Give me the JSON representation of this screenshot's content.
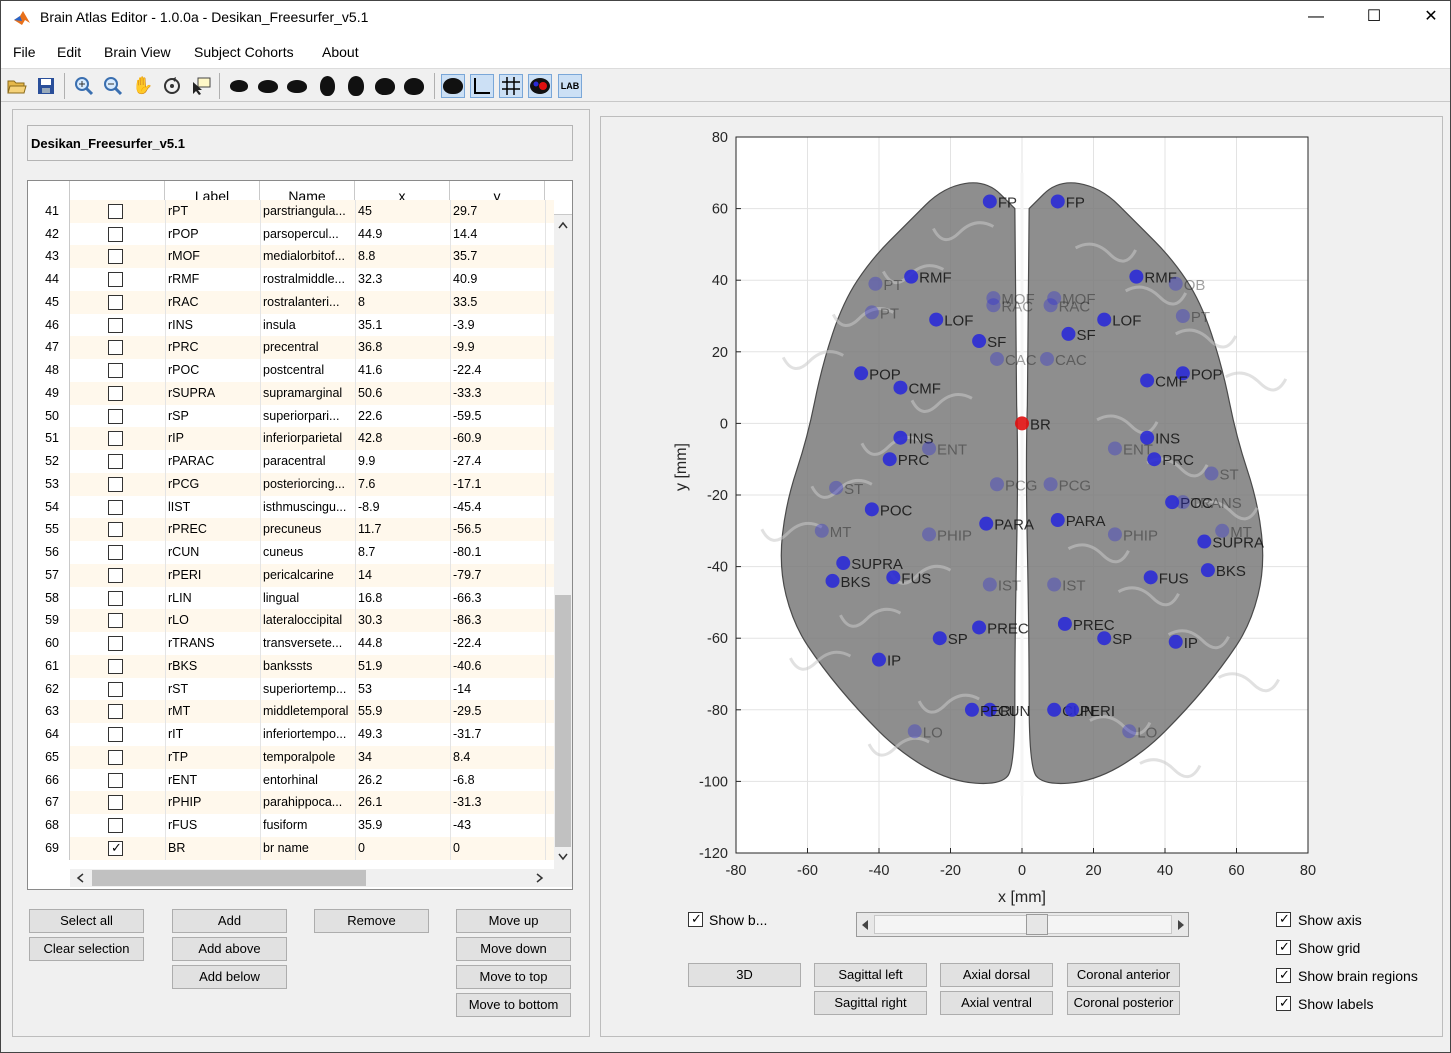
{
  "window": {
    "title": "Brain Atlas Editor - 1.0.0a - Desikan_Freesurfer_v5.1",
    "controls": {
      "minimize": "—",
      "maximize": "☐",
      "close": "✕"
    }
  },
  "menu": [
    "File",
    "Edit",
    "Brain View",
    "Subject Cohorts",
    "About"
  ],
  "toolbar": {
    "file_icons": [
      "open-icon",
      "save-icon"
    ],
    "tool_icons": [
      "zoom-in-icon",
      "zoom-out-icon",
      "pan-icon",
      "rotate-icon",
      "data-cursor-icon"
    ],
    "view_icons": [
      "brain-left-icon",
      "brain-sagittal-icon",
      "brain-sagittal-right-icon",
      "brain-axial-dorsal-icon",
      "brain-axial-ventral-icon",
      "brain-coronal-anterior-icon",
      "brain-coronal-posterior-icon"
    ],
    "toggle_icons": [
      "brain-surface-icon",
      "axis-icon",
      "grid-icon",
      "brain-regions-icon",
      "labels-icon"
    ],
    "labels_text": "LAB"
  },
  "atlas_name": "Desikan_Freesurfer_v5.1",
  "table": {
    "headers": [
      "",
      "",
      "Label",
      "Name",
      "x",
      "y"
    ],
    "partial_row": {
      "num": "41",
      "label": "rPT",
      "name": "parstriangula...",
      "x": "45",
      "y": "29.7"
    },
    "rows": [
      {
        "num": "42",
        "checked": false,
        "label": "rPOP",
        "name": "parsopercul...",
        "x": "44.9",
        "y": "14.4"
      },
      {
        "num": "43",
        "checked": false,
        "label": "rMOF",
        "name": "medialorbitof...",
        "x": "8.8",
        "y": "35.7"
      },
      {
        "num": "44",
        "checked": false,
        "label": "rRMF",
        "name": "rostralmiddle...",
        "x": "32.3",
        "y": "40.9"
      },
      {
        "num": "45",
        "checked": false,
        "label": "rRAC",
        "name": "rostralanteri...",
        "x": "8",
        "y": "33.5"
      },
      {
        "num": "46",
        "checked": false,
        "label": "rINS",
        "name": "insula",
        "x": "35.1",
        "y": "-3.9"
      },
      {
        "num": "47",
        "checked": false,
        "label": "rPRC",
        "name": "precentral",
        "x": "36.8",
        "y": "-9.9"
      },
      {
        "num": "48",
        "checked": false,
        "label": "rPOC",
        "name": "postcentral",
        "x": "41.6",
        "y": "-22.4"
      },
      {
        "num": "49",
        "checked": false,
        "label": "rSUPRA",
        "name": "supramarginal",
        "x": "50.6",
        "y": "-33.3"
      },
      {
        "num": "50",
        "checked": false,
        "label": "rSP",
        "name": "superiorpari...",
        "x": "22.6",
        "y": "-59.5"
      },
      {
        "num": "51",
        "checked": false,
        "label": "rIP",
        "name": "inferiorparietal",
        "x": "42.8",
        "y": "-60.9"
      },
      {
        "num": "52",
        "checked": false,
        "label": "rPARAC",
        "name": "paracentral",
        "x": "9.9",
        "y": "-27.4"
      },
      {
        "num": "53",
        "checked": false,
        "label": "rPCG",
        "name": "posteriorcing...",
        "x": "7.6",
        "y": "-17.1"
      },
      {
        "num": "54",
        "checked": false,
        "label": "lIST",
        "name": "isthmuscingu...",
        "x": "-8.9",
        "y": "-45.4"
      },
      {
        "num": "55",
        "checked": false,
        "label": "rPREC",
        "name": "precuneus",
        "x": "11.7",
        "y": "-56.5"
      },
      {
        "num": "56",
        "checked": false,
        "label": "rCUN",
        "name": "cuneus",
        "x": "8.7",
        "y": "-80.1"
      },
      {
        "num": "57",
        "checked": false,
        "label": "rPERI",
        "name": "pericalcarine",
        "x": "14",
        "y": "-79.7"
      },
      {
        "num": "58",
        "checked": false,
        "label": "rLIN",
        "name": "lingual",
        "x": "16.8",
        "y": "-66.3"
      },
      {
        "num": "59",
        "checked": false,
        "label": "rLO",
        "name": "lateraloccipital",
        "x": "30.3",
        "y": "-86.3"
      },
      {
        "num": "60",
        "checked": false,
        "label": "rTRANS",
        "name": "transversete...",
        "x": "44.8",
        "y": "-22.4"
      },
      {
        "num": "61",
        "checked": false,
        "label": "rBKS",
        "name": "bankssts",
        "x": "51.9",
        "y": "-40.6"
      },
      {
        "num": "62",
        "checked": false,
        "label": "rST",
        "name": "superiortemp...",
        "x": "53",
        "y": "-14"
      },
      {
        "num": "63",
        "checked": false,
        "label": "rMT",
        "name": "middletemporal",
        "x": "55.9",
        "y": "-29.5"
      },
      {
        "num": "64",
        "checked": false,
        "label": "rIT",
        "name": "inferiortempo...",
        "x": "49.3",
        "y": "-31.7"
      },
      {
        "num": "65",
        "checked": false,
        "label": "rTP",
        "name": "temporalpole",
        "x": "34",
        "y": "8.4"
      },
      {
        "num": "66",
        "checked": false,
        "label": "rENT",
        "name": "entorhinal",
        "x": "26.2",
        "y": "-6.8"
      },
      {
        "num": "67",
        "checked": false,
        "label": "rPHIP",
        "name": "parahippoca...",
        "x": "26.1",
        "y": "-31.3"
      },
      {
        "num": "68",
        "checked": false,
        "label": "rFUS",
        "name": "fusiform",
        "x": "35.9",
        "y": "-43"
      },
      {
        "num": "69",
        "checked": true,
        "label": "BR",
        "name": "br name",
        "x": "0",
        "y": "0"
      }
    ]
  },
  "buttons": {
    "select_all": "Select all",
    "clear_selection": "Clear selection",
    "add": "Add",
    "add_above": "Add above",
    "add_below": "Add below",
    "remove": "Remove",
    "move_up": "Move up",
    "move_down": "Move down",
    "move_to_top": "Move to top",
    "move_to_bottom": "Move to bottom"
  },
  "view_controls": {
    "show_brain": {
      "label": "Show b...",
      "checked": true
    },
    "slider_value": 0.55,
    "buttons": [
      "3D",
      "Sagittal left",
      "Sagittal right",
      "Axial dorsal",
      "Axial ventral",
      "Coronal anterior",
      "Coronal posterior"
    ],
    "show_axis": {
      "label": "Show axis",
      "checked": true
    },
    "show_grid": {
      "label": "Show grid",
      "checked": true
    },
    "show_brain_regions": {
      "label": "Show brain regions",
      "checked": true
    },
    "show_labels": {
      "label": "Show labels",
      "checked": true
    }
  },
  "chart_data": {
    "type": "scatter",
    "xlabel": "x [mm]",
    "ylabel": "y [mm]",
    "xlim": [
      -80,
      80
    ],
    "ylim": [
      -120,
      80
    ],
    "xticks": [
      -80,
      -60,
      -40,
      -20,
      0,
      20,
      40,
      60,
      80
    ],
    "yticks": [
      -120,
      -100,
      -80,
      -60,
      -40,
      -20,
      0,
      20,
      40,
      60,
      80
    ],
    "grid": true,
    "colors": {
      "region": "#2b2bd6",
      "selected": "#e01010",
      "brain": "#7a7a7a"
    },
    "points": [
      {
        "label": "FP",
        "x": -9,
        "y": 62,
        "hidden": false
      },
      {
        "label": "FP",
        "x": 10,
        "y": 62,
        "hidden": false
      },
      {
        "label": "RMF",
        "x": -31,
        "y": 41,
        "hidden": false
      },
      {
        "label": "RMF",
        "x": 32,
        "y": 41,
        "hidden": false
      },
      {
        "label": "PT",
        "x": -41,
        "y": 39,
        "hidden": true
      },
      {
        "label": "OB",
        "x": 43,
        "y": 39,
        "hidden": true
      },
      {
        "label": "LOF",
        "x": -24,
        "y": 29,
        "hidden": false
      },
      {
        "label": "LOF",
        "x": 23,
        "y": 29,
        "hidden": false
      },
      {
        "label": "MOF",
        "x": -8,
        "y": 35,
        "hidden": true
      },
      {
        "label": "MOF",
        "x": 9,
        "y": 35,
        "hidden": true
      },
      {
        "label": "RAC",
        "x": -8,
        "y": 33,
        "hidden": true
      },
      {
        "label": "RAC",
        "x": 8,
        "y": 33,
        "hidden": true
      },
      {
        "label": "PT",
        "x": -42,
        "y": 31,
        "hidden": true
      },
      {
        "label": "PT",
        "x": 45,
        "y": 30,
        "hidden": true
      },
      {
        "label": "SF",
        "x": -12,
        "y": 23,
        "hidden": false
      },
      {
        "label": "SF",
        "x": 13,
        "y": 25,
        "hidden": false
      },
      {
        "label": "CAC",
        "x": -7,
        "y": 18,
        "hidden": true
      },
      {
        "label": "CAC",
        "x": 7,
        "y": 18,
        "hidden": true
      },
      {
        "label": "POP",
        "x": -45,
        "y": 14,
        "hidden": false
      },
      {
        "label": "POP",
        "x": 45,
        "y": 14,
        "hidden": false
      },
      {
        "label": "CMF",
        "x": -34,
        "y": 10,
        "hidden": false
      },
      {
        "label": "CMF",
        "x": 35,
        "y": 12,
        "hidden": false
      },
      {
        "label": "BR",
        "x": 0,
        "y": 0,
        "hidden": false,
        "selected": true
      },
      {
        "label": "INS",
        "x": -34,
        "y": -4,
        "hidden": false
      },
      {
        "label": "INS",
        "x": 35,
        "y": -4,
        "hidden": false
      },
      {
        "label": "ENT",
        "x": -26,
        "y": -7,
        "hidden": true
      },
      {
        "label": "ENT",
        "x": 26,
        "y": -7,
        "hidden": true
      },
      {
        "label": "PRC",
        "x": -37,
        "y": -10,
        "hidden": false
      },
      {
        "label": "PRC",
        "x": 37,
        "y": -10,
        "hidden": false
      },
      {
        "label": "ST",
        "x": -52,
        "y": -18,
        "hidden": true
      },
      {
        "label": "ST",
        "x": 53,
        "y": -14,
        "hidden": true
      },
      {
        "label": "PCG",
        "x": -7,
        "y": -17,
        "hidden": true
      },
      {
        "label": "PCG",
        "x": 8,
        "y": -17,
        "hidden": true
      },
      {
        "label": "POC",
        "x": -42,
        "y": -24,
        "hidden": false
      },
      {
        "label": "POC",
        "x": 42,
        "y": -22,
        "hidden": false
      },
      {
        "label": "TRANS",
        "x": 45,
        "y": -22,
        "hidden": true
      },
      {
        "label": "PARA",
        "x": -10,
        "y": -28,
        "hidden": false
      },
      {
        "label": "PARA",
        "x": 10,
        "y": -27,
        "hidden": false
      },
      {
        "label": "PHIP",
        "x": -26,
        "y": -31,
        "hidden": true
      },
      {
        "label": "PHIP",
        "x": 26,
        "y": -31,
        "hidden": true
      },
      {
        "label": "MT",
        "x": -56,
        "y": -30,
        "hidden": true
      },
      {
        "label": "MT",
        "x": 56,
        "y": -30,
        "hidden": true
      },
      {
        "label": "SUPRA",
        "x": -50,
        "y": -39,
        "hidden": false
      },
      {
        "label": "SUPRA",
        "x": 51,
        "y": -33,
        "hidden": false
      },
      {
        "label": "BKS",
        "x": -53,
        "y": -44,
        "hidden": false
      },
      {
        "label": "BKS",
        "x": 52,
        "y": -41,
        "hidden": false
      },
      {
        "label": "FUS",
        "x": -36,
        "y": -43,
        "hidden": false
      },
      {
        "label": "FUS",
        "x": 36,
        "y": -43,
        "hidden": false
      },
      {
        "label": "IST",
        "x": -9,
        "y": -45,
        "hidden": true
      },
      {
        "label": "IST",
        "x": 9,
        "y": -45,
        "hidden": true
      },
      {
        "label": "PREC",
        "x": -12,
        "y": -57,
        "hidden": false
      },
      {
        "label": "PREC",
        "x": 12,
        "y": -56,
        "hidden": false
      },
      {
        "label": "SP",
        "x": -23,
        "y": -60,
        "hidden": false
      },
      {
        "label": "SP",
        "x": 23,
        "y": -60,
        "hidden": false
      },
      {
        "label": "IP",
        "x": -40,
        "y": -66,
        "hidden": false
      },
      {
        "label": "IP",
        "x": 43,
        "y": -61,
        "hidden": false
      },
      {
        "label": "CUN",
        "x": -9,
        "y": -80,
        "hidden": false
      },
      {
        "label": "CUN",
        "x": 9,
        "y": -80,
        "hidden": false
      },
      {
        "label": "PERI",
        "x": -14,
        "y": -80,
        "hidden": false
      },
      {
        "label": "PERI",
        "x": 14,
        "y": -80,
        "hidden": false
      },
      {
        "label": "LO",
        "x": -30,
        "y": -86,
        "hidden": true
      },
      {
        "label": "LO",
        "x": 30,
        "y": -86,
        "hidden": true
      }
    ]
  }
}
